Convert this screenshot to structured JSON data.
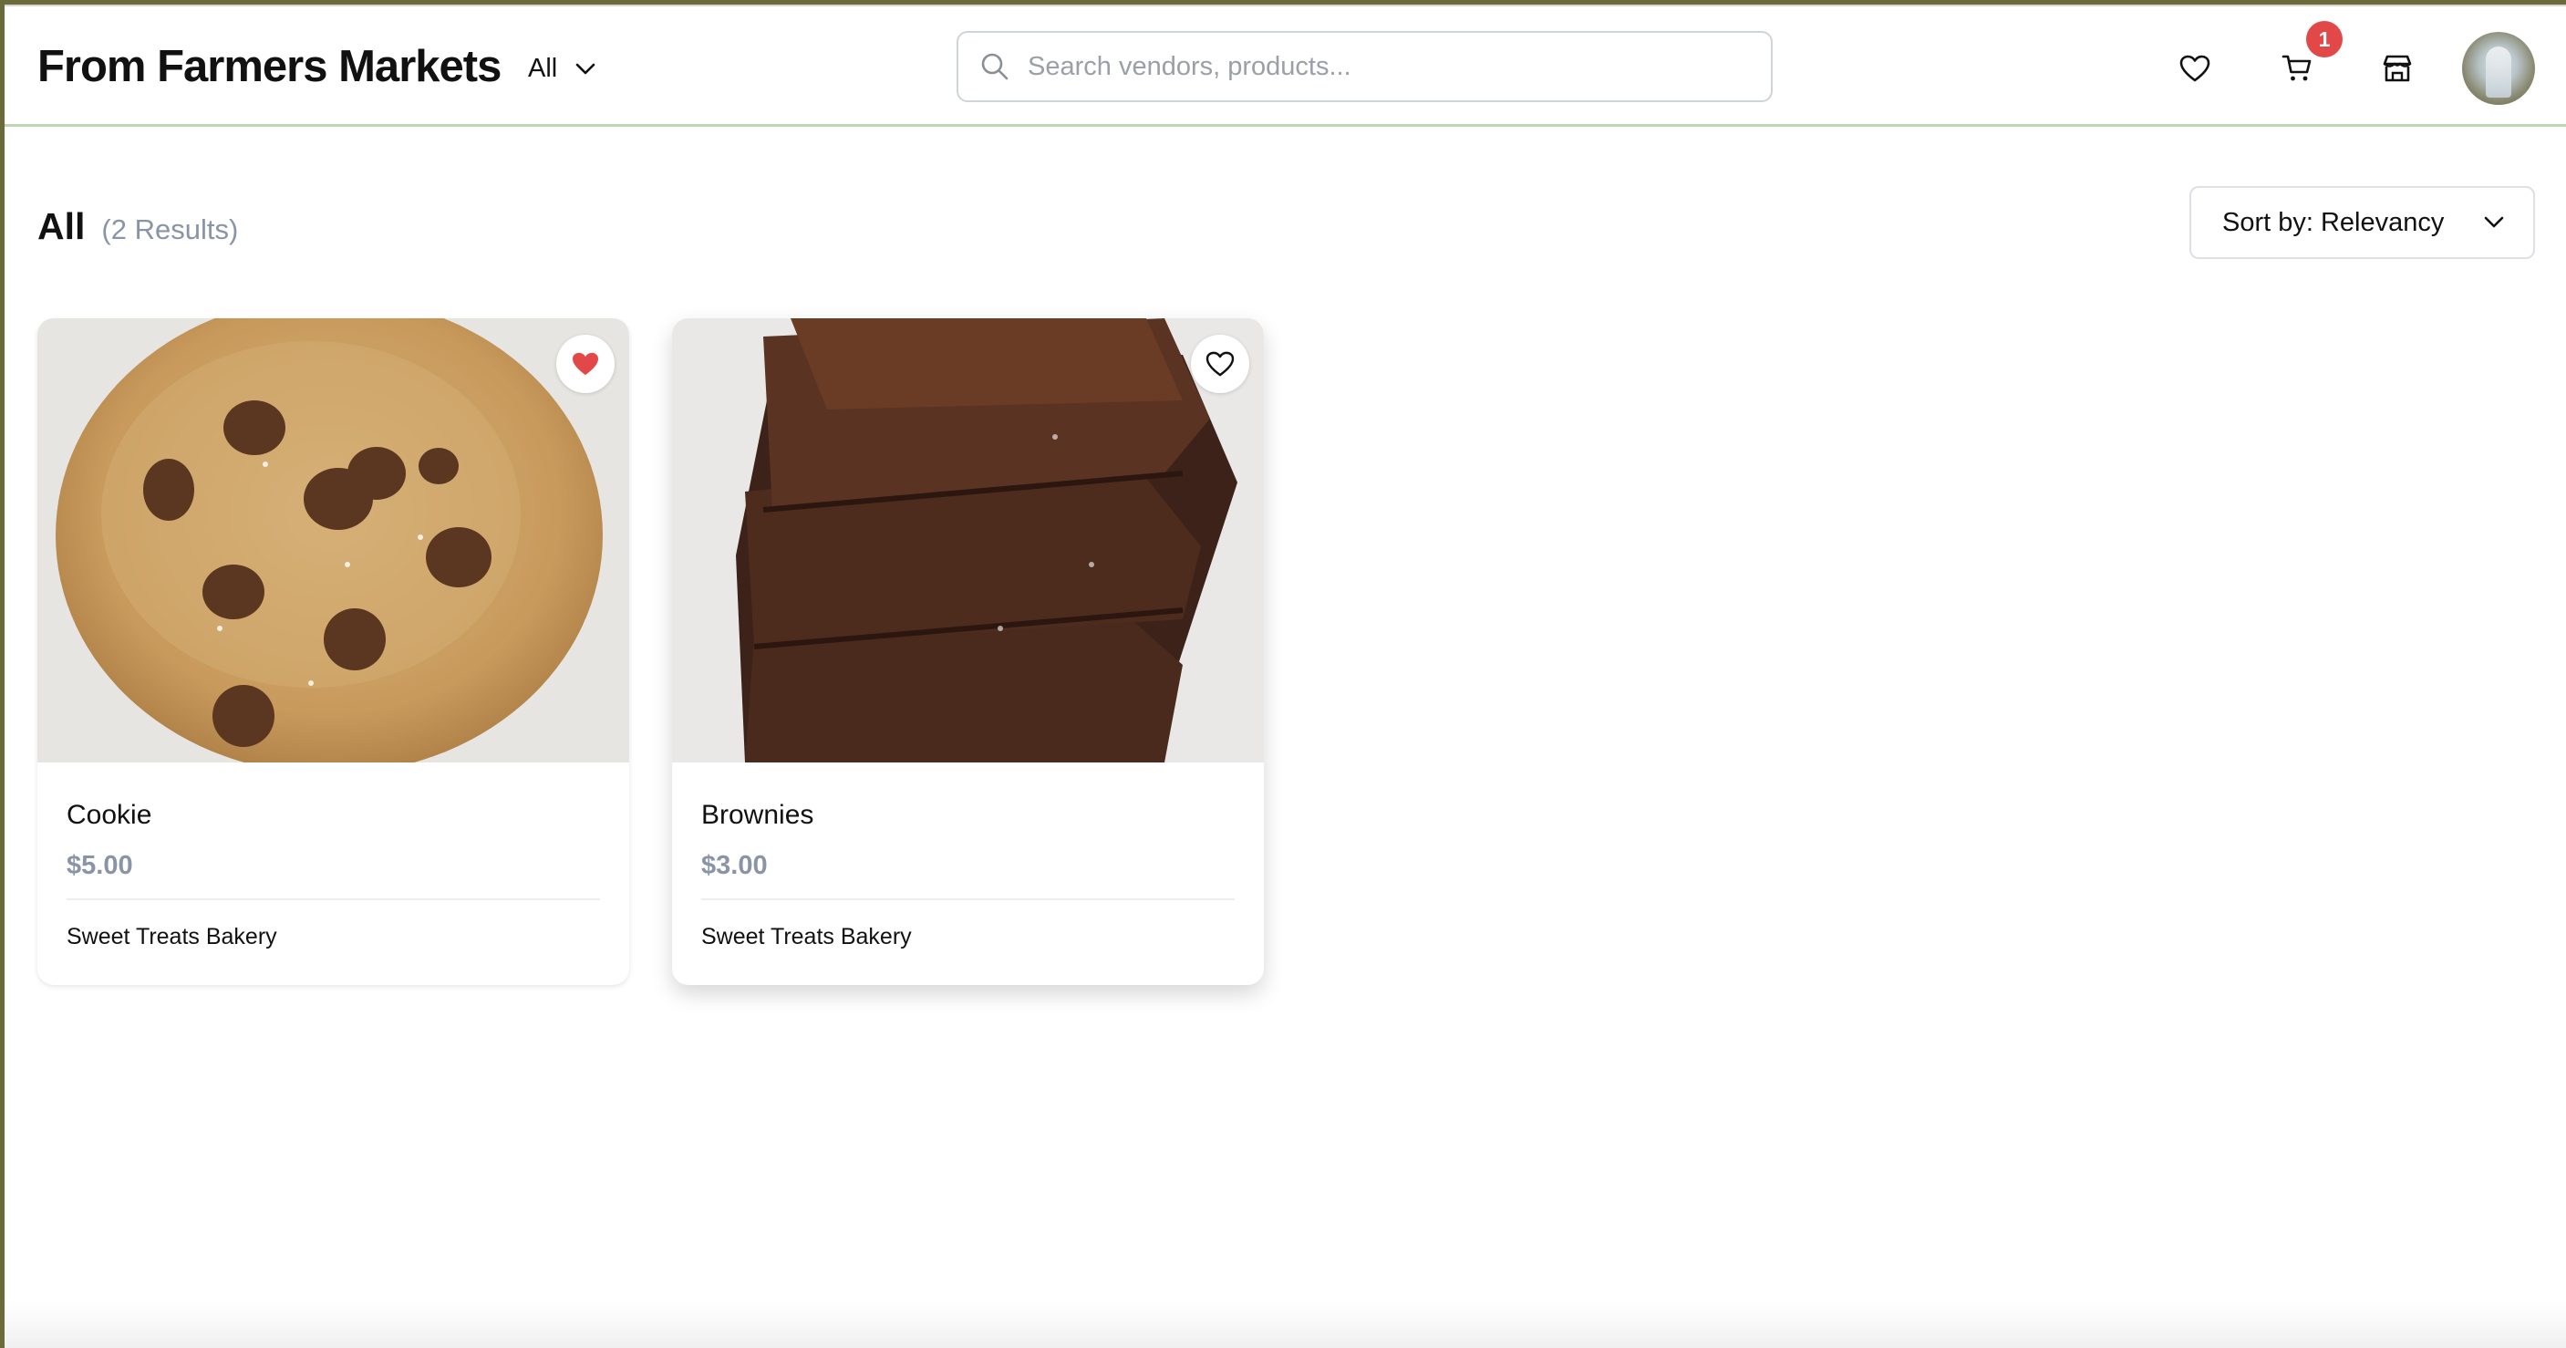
{
  "header": {
    "brand": "From Farmers Markets",
    "category_filter": "All",
    "search_placeholder": "Search vendors, products...",
    "cart_count": "1"
  },
  "results": {
    "title": "All",
    "count_label": "(2 Results)",
    "sort_label": "Sort by: Relevancy"
  },
  "products": [
    {
      "name": "Cookie",
      "price": "$5.00",
      "vendor": "Sweet Treats Bakery",
      "favorited": true
    },
    {
      "name": "Brownies",
      "price": "$3.00",
      "vendor": "Sweet Treats Bakery",
      "favorited": false
    }
  ],
  "icons": {
    "search": "search-icon",
    "favorites": "heart-icon",
    "cart": "cart-icon",
    "store": "store-icon",
    "dropdown": "chevron-down-icon"
  },
  "colors": {
    "accent_border": "#b9d7b0",
    "badge": "#e34848",
    "heart_filled": "#e34848",
    "price": "#8a94a6"
  }
}
